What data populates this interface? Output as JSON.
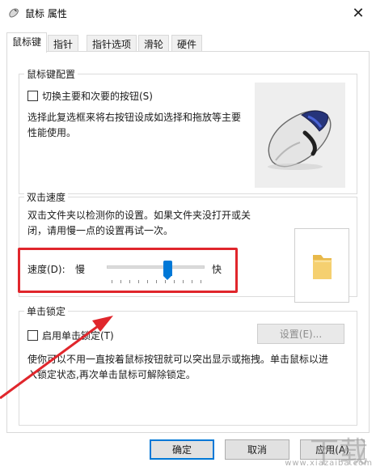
{
  "window": {
    "title": "鼠标 属性",
    "close_glyph": "✕"
  },
  "tabs": [
    {
      "label": "鼠标键",
      "active": true
    },
    {
      "label": "指针",
      "active": false
    },
    {
      "label": "指针选项",
      "active": false
    },
    {
      "label": "滑轮",
      "active": false
    },
    {
      "label": "硬件",
      "active": false
    }
  ],
  "button_config": {
    "title": "鼠标键配置",
    "checkbox_label": "切换主要和次要的按钮(S)",
    "checked": false,
    "description_line1": "选择此复选框来将右按钮设成如选择和拖放等主要",
    "description_line2": "性能使用。"
  },
  "double_click": {
    "title": "双击速度",
    "description_line1": "双击文件夹以检测你的设置。如果文件夹没打开或关",
    "description_line2": "闭，请用慢一点的设置再试一次。",
    "speed_label": "速度(D):",
    "slow_label": "慢",
    "fast_label": "快",
    "speed_fraction": 0.64
  },
  "click_lock": {
    "title": "单击锁定",
    "checkbox_label": "启用单击锁定(T)",
    "checked": false,
    "settings_button": "设置(E)...",
    "description_line1": "使你可以不用一直按着鼠标按钮就可以突出显示或拖拽。单击鼠标以进",
    "description_line2": "入锁定状态,再次单击鼠标可解除锁定。"
  },
  "footer": {
    "ok": "确定",
    "cancel": "取消",
    "apply": "应用(A)"
  },
  "watermark": {
    "big": "下载",
    "small": "www.xiazaiba.com"
  },
  "colors": {
    "accent": "#0078d7",
    "annotation": "#e0262c"
  }
}
